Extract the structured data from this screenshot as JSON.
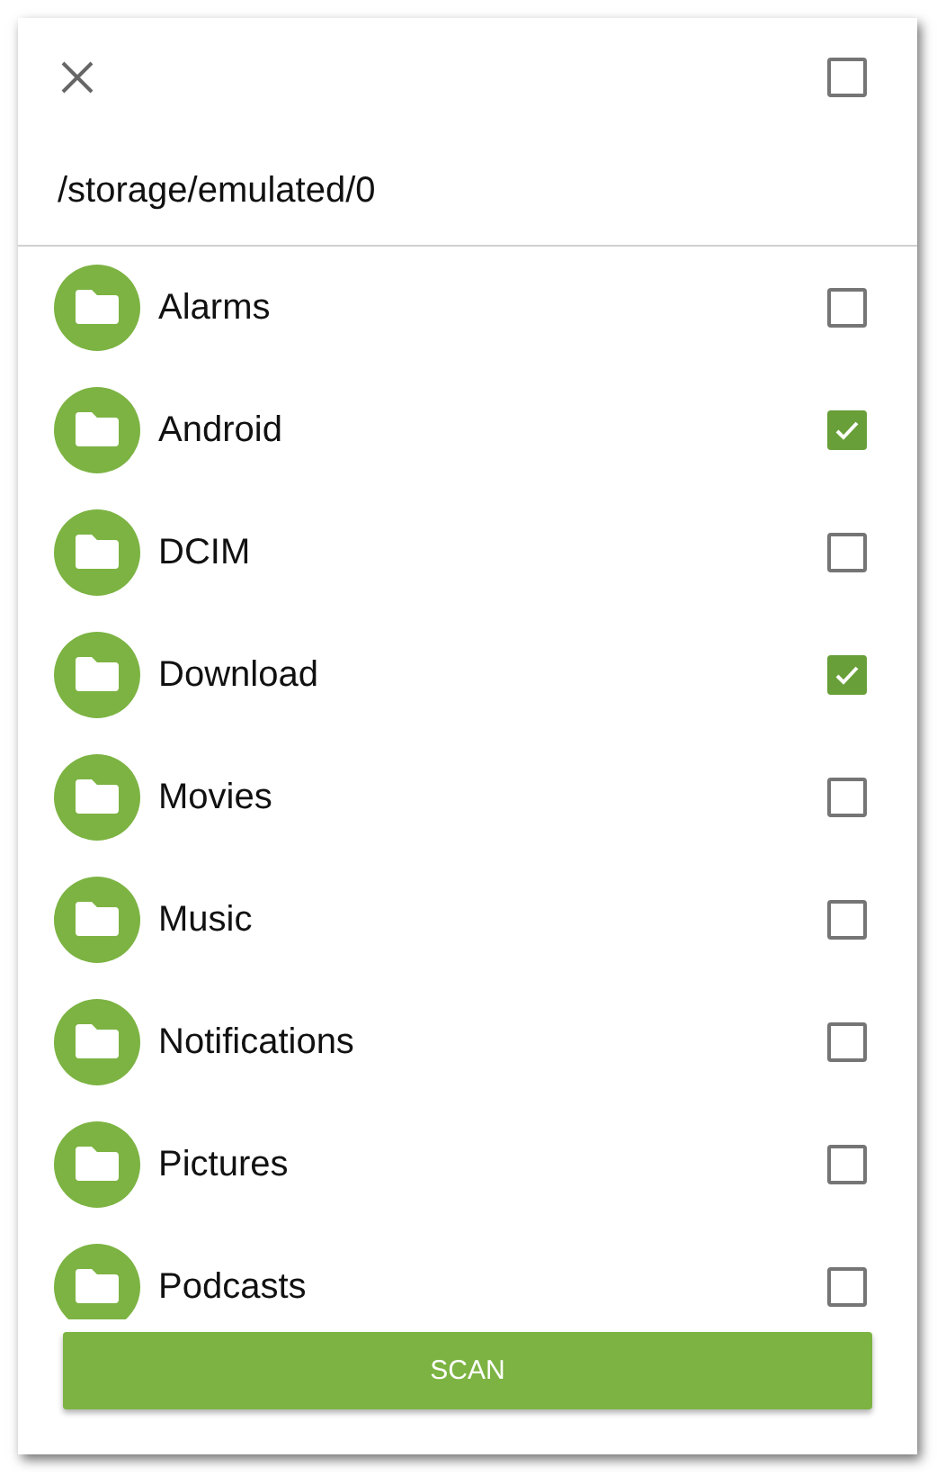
{
  "header": {
    "select_all_checked": false
  },
  "path": "/storage/emulated/0",
  "folders": [
    {
      "name": "Alarms",
      "checked": false
    },
    {
      "name": "Android",
      "checked": true
    },
    {
      "name": "DCIM",
      "checked": false
    },
    {
      "name": "Download",
      "checked": true
    },
    {
      "name": "Movies",
      "checked": false
    },
    {
      "name": "Music",
      "checked": false
    },
    {
      "name": "Notifications",
      "checked": false
    },
    {
      "name": "Pictures",
      "checked": false
    },
    {
      "name": "Podcasts",
      "checked": false
    }
  ],
  "button": "SCAN"
}
